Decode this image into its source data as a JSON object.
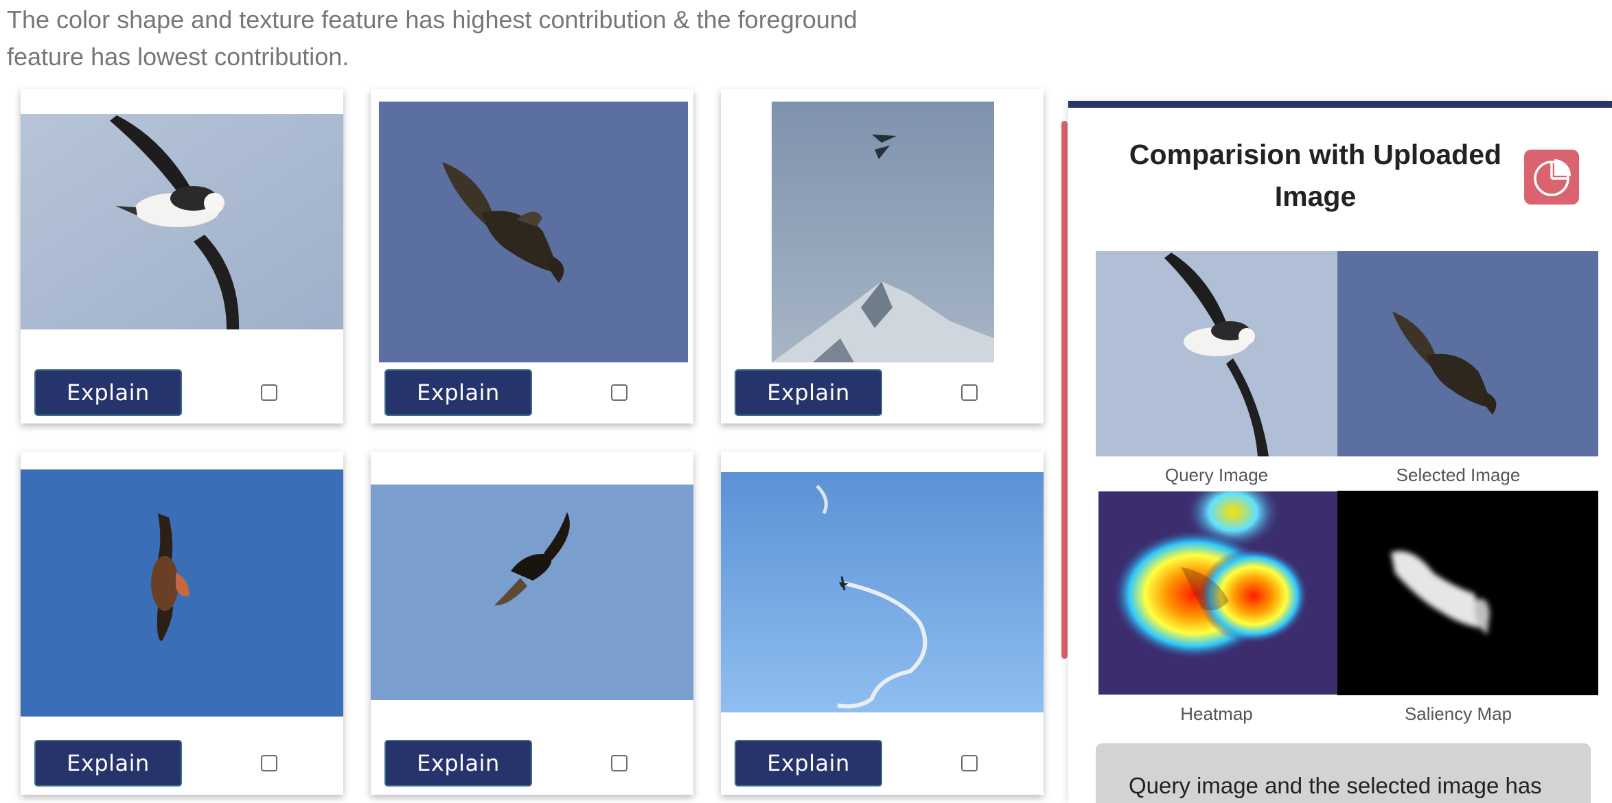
{
  "intro_text": "The color shape and texture feature has highest contribution & the foreground feature has lowest contribution.",
  "results": [
    {
      "subject": "albatross",
      "explain_label": "Explain",
      "checked": false
    },
    {
      "subject": "eagle",
      "explain_label": "Explain",
      "checked": false
    },
    {
      "subject": "jets over mountain",
      "explain_label": "Explain",
      "checked": false
    },
    {
      "subject": "hawk",
      "explain_label": "Explain",
      "checked": false
    },
    {
      "subject": "vulture",
      "explain_label": "Explain",
      "checked": false
    },
    {
      "subject": "airplane with smoke trail",
      "explain_label": "Explain",
      "checked": false
    }
  ],
  "panel": {
    "title": "Comparision with Uploaded Image",
    "chart_icon": "pie-chart-icon",
    "captions": {
      "query": "Query Image",
      "selected": "Selected Image",
      "heatmap": "Heatmap",
      "saliency": "Saliency Map"
    },
    "note": "Query image and the selected image has"
  },
  "colors": {
    "accent": "#27336b",
    "highlight": "#d9636f",
    "note_bg": "#d3d3d3"
  }
}
